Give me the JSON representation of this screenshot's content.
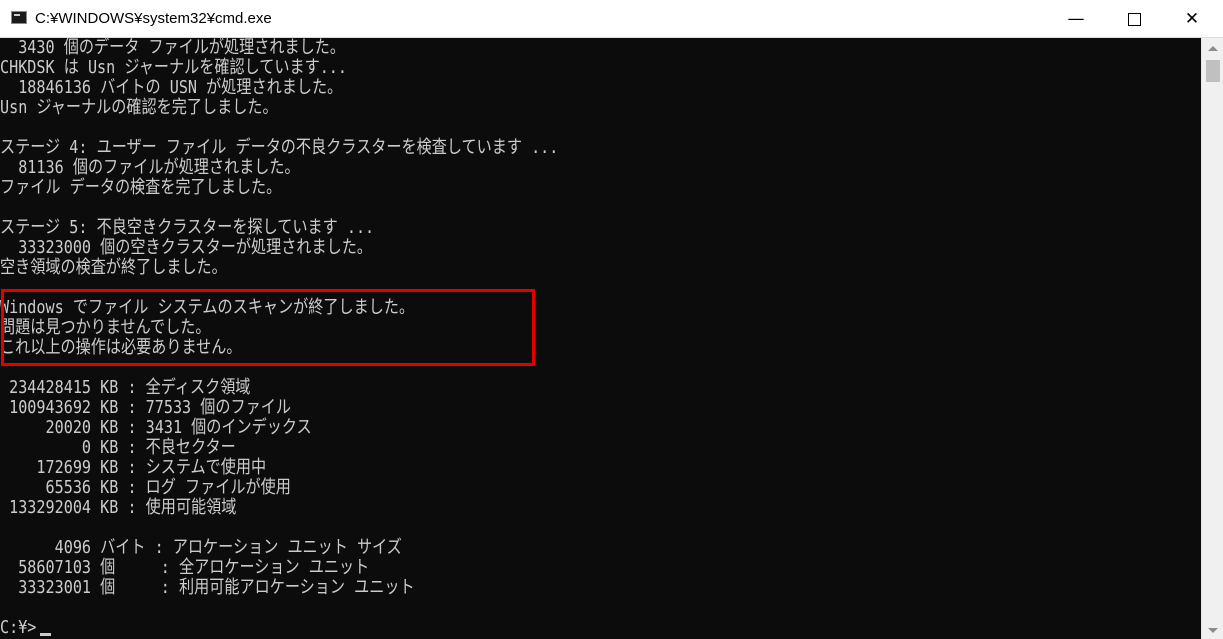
{
  "window": {
    "title": "C:¥WINDOWS¥system32¥cmd.exe",
    "icon": "terminal-icon",
    "minimize_glyph": "—",
    "close_glyph": "✕"
  },
  "console": {
    "lines": [
      "  3430 個のデータ ファイルが処理されました。",
      "CHKDSK は Usn ジャーナルを確認しています...",
      "  18846136 バイトの USN が処理されました。",
      "Usn ジャーナルの確認を完了しました。",
      "",
      "ステージ 4: ユーザー ファイル データの不良クラスターを検査しています ...",
      "  81136 個のファイルが処理されました。",
      "ファイル データの検査を完了しました。",
      "",
      "ステージ 5: 不良空きクラスターを探しています ...",
      "  33323000 個の空きクラスターが処理されました。",
      "空き領域の検査が終了しました。",
      "",
      "Windows でファイル システムのスキャンが終了しました。",
      "問題は見つかりませんでした。",
      "これ以上の操作は必要ありません。",
      "",
      " 234428415 KB : 全ディスク領域",
      " 100943692 KB : 77533 個のファイル",
      "     20020 KB : 3431 個のインデックス",
      "         0 KB : 不良セクター",
      "    172699 KB : システムで使用中",
      "     65536 KB : ログ ファイルが使用",
      " 133292004 KB : 使用可能領域",
      "",
      "      4096 バイト : アロケーション ユニット サイズ",
      "  58607103 個     : 全アロケーション ユニット",
      "  33323001 個     : 利用可能アロケーション ユニット",
      "",
      "C:¥>"
    ],
    "highlight_color": "#e00000",
    "text_color": "#cccccc",
    "background_color": "#0c0c0c"
  }
}
